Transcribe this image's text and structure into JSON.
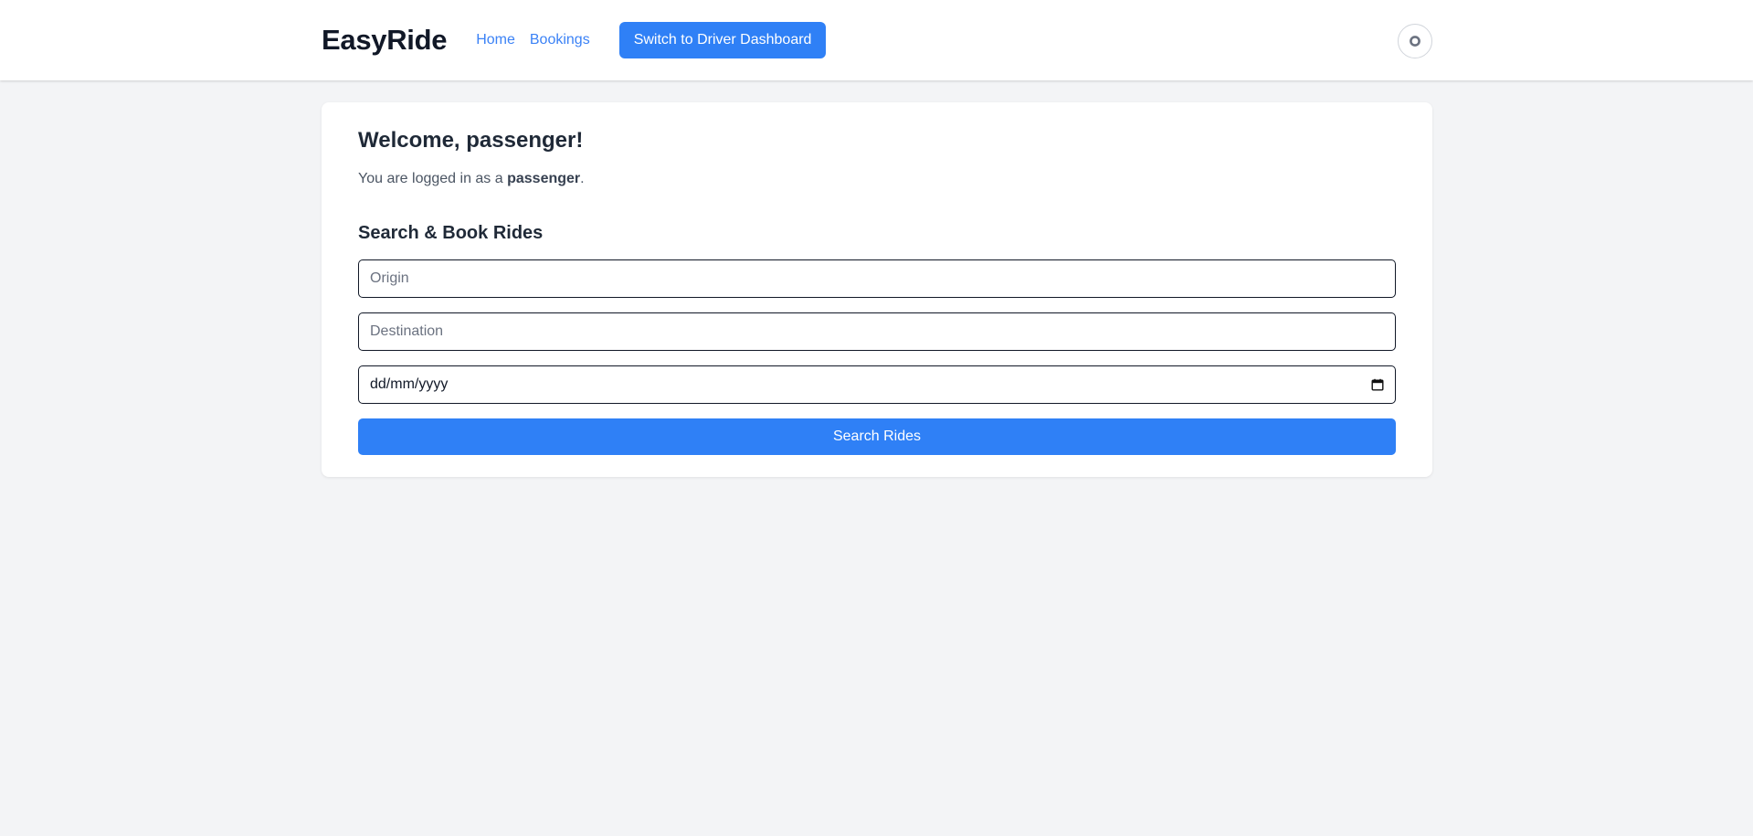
{
  "header": {
    "brand": "EasyRide",
    "nav": {
      "home": "Home",
      "bookings": "Bookings"
    },
    "switch_button": "Switch to Driver Dashboard",
    "theme_toggle_icon": "circle-icon"
  },
  "main": {
    "welcome_title": "Welcome, passenger!",
    "logged_in_prefix": "You are logged in as a ",
    "logged_in_role": "passenger",
    "logged_in_suffix": ".",
    "search_section_title": "Search & Book Rides",
    "origin": {
      "placeholder": "Origin",
      "value": ""
    },
    "destination": {
      "placeholder": "Destination",
      "value": ""
    },
    "date": {
      "placeholder": "dd/mm/yyyy",
      "icon": "calendar-icon"
    },
    "search_button": "Search Rides"
  },
  "colors": {
    "primary": "#2f80f6",
    "link": "#3b82f6",
    "background": "#f3f4f6",
    "card": "#ffffff",
    "heading": "#1f2937"
  }
}
